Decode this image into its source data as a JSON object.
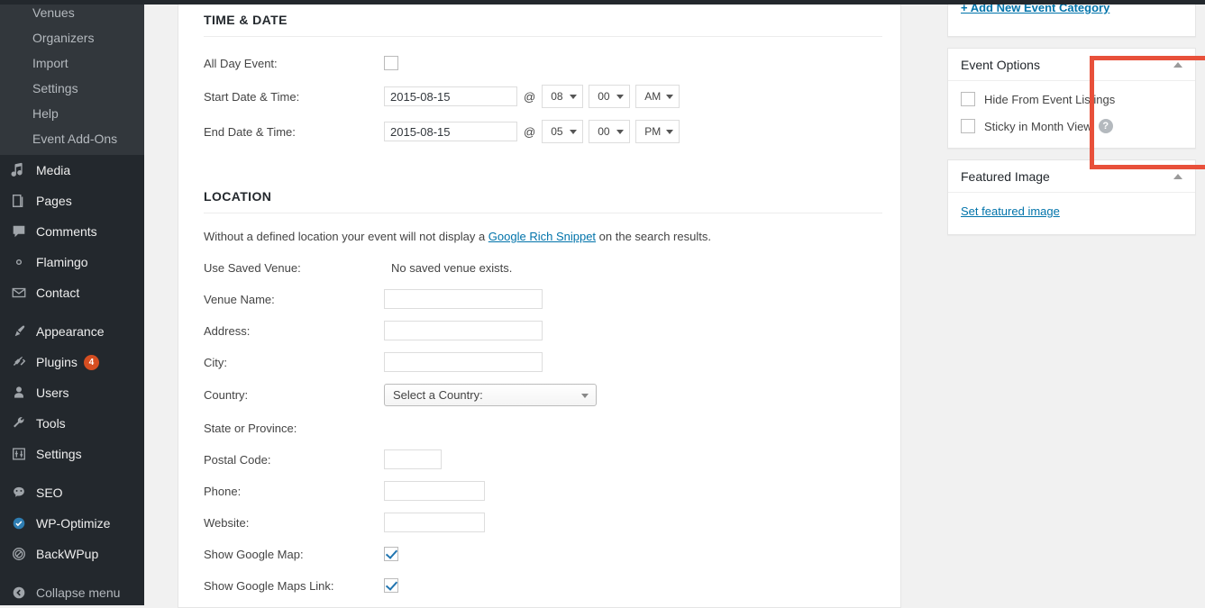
{
  "sidebar": {
    "submenu": [
      {
        "label": "Venues"
      },
      {
        "label": "Organizers"
      },
      {
        "label": "Import"
      },
      {
        "label": "Settings"
      },
      {
        "label": "Help"
      },
      {
        "label": "Event Add-Ons"
      }
    ],
    "menu_group_1": [
      {
        "label": "Media",
        "icon": "media-icon"
      },
      {
        "label": "Pages",
        "icon": "pages-icon"
      },
      {
        "label": "Comments",
        "icon": "comments-icon"
      },
      {
        "label": "Flamingo",
        "icon": "gear-icon"
      },
      {
        "label": "Contact",
        "icon": "envelope-icon"
      }
    ],
    "menu_group_2": [
      {
        "label": "Appearance",
        "icon": "brush-icon",
        "badge": ""
      },
      {
        "label": "Plugins",
        "icon": "plug-icon",
        "badge": "4"
      },
      {
        "label": "Users",
        "icon": "user-icon",
        "badge": ""
      },
      {
        "label": "Tools",
        "icon": "wrench-icon",
        "badge": ""
      },
      {
        "label": "Settings",
        "icon": "sliders-icon",
        "badge": ""
      }
    ],
    "menu_group_3": [
      {
        "label": "SEO",
        "icon": "seo-icon"
      },
      {
        "label": "WP-Optimize",
        "icon": "check-circle-icon"
      },
      {
        "label": "BackWPup",
        "icon": "backwpup-icon"
      }
    ],
    "collapse": {
      "label": "Collapse menu",
      "icon": "collapse-arrow-icon"
    },
    "badge_color": "#d54e21"
  },
  "time_date": {
    "title": "TIME & DATE",
    "all_day": {
      "label": "All Day Event:",
      "checked": false
    },
    "start": {
      "label": "Start Date & Time:",
      "date": "2015-08-15",
      "at": "@",
      "hour": "08",
      "minute": "00",
      "meridiem": "AM"
    },
    "end": {
      "label": "End Date & Time:",
      "date": "2015-08-15",
      "at": "@",
      "hour": "05",
      "minute": "00",
      "meridiem": "PM"
    }
  },
  "location": {
    "title": "LOCATION",
    "note_before": "Without a defined location your event will not display a ",
    "note_link": "Google Rich Snippet",
    "note_after": " on the search results.",
    "use_saved_venue": {
      "label": "Use Saved Venue:",
      "value": "No saved venue exists."
    },
    "venue_name": {
      "label": "Venue Name:",
      "value": ""
    },
    "address": {
      "label": "Address:",
      "value": ""
    },
    "city": {
      "label": "City:",
      "value": ""
    },
    "country": {
      "label": "Country:",
      "value": "Select a Country:"
    },
    "state": {
      "label": "State or Province:",
      "value": ""
    },
    "postal_code": {
      "label": "Postal Code:",
      "value": ""
    },
    "phone": {
      "label": "Phone:",
      "value": ""
    },
    "website": {
      "label": "Website:",
      "value": ""
    },
    "show_google_map": {
      "label": "Show Google Map:",
      "checked": true
    },
    "show_google_maps_link": {
      "label": "Show Google Maps Link:",
      "checked": true
    }
  },
  "side": {
    "add_category_link": "+ Add New Event Category",
    "event_options": {
      "title": "Event Options",
      "hide_from_listings": {
        "label": "Hide From Event Listings",
        "checked": false
      },
      "sticky_month_view": {
        "label": "Sticky in Month View",
        "checked": false,
        "help": "?"
      },
      "highlight_color": "#e8503a"
    },
    "featured_image": {
      "title": "Featured Image",
      "set_link": "Set featured image"
    }
  }
}
